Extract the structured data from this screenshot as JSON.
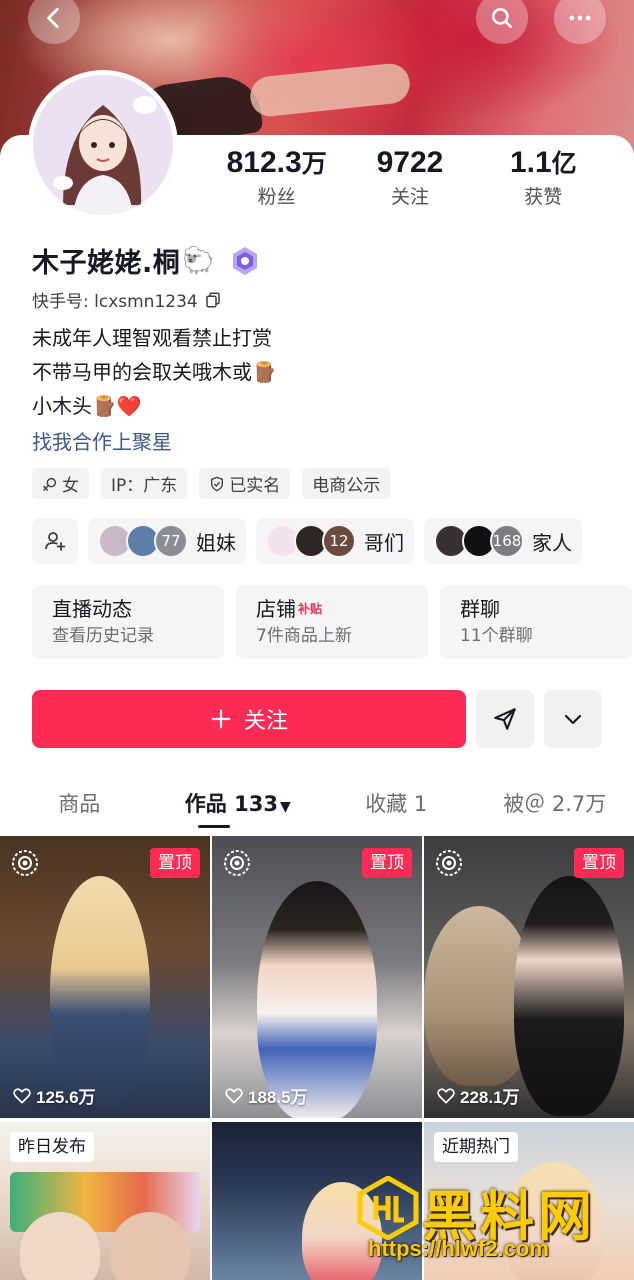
{
  "profile": {
    "name": "木子姥姥.桐",
    "name_emoji": "🐑",
    "kuaishou_id": "快手号: lcxsmn1234",
    "stats": [
      {
        "value": "812.3",
        "unit": "万",
        "label": "粉丝"
      },
      {
        "value": "9722",
        "unit": "",
        "label": "关注"
      },
      {
        "value": "1.1",
        "unit": "亿",
        "label": "获赞"
      }
    ],
    "bio_lines": [
      "未成年人理智观看禁止打赏",
      "不带马甲的会取关哦木或🪵",
      "小木头🪵❤️"
    ],
    "cooperate_link": "找我合作上聚星",
    "tags": [
      {
        "icon": "female-icon",
        "text": "女"
      },
      {
        "icon": "",
        "text": "IP：广东"
      },
      {
        "icon": "verified-shield-icon",
        "text": "已实名"
      },
      {
        "icon": "",
        "text": "电商公示"
      }
    ]
  },
  "groups": [
    {
      "label": "姐妹",
      "count": "77"
    },
    {
      "label": "哥们",
      "count": "12"
    },
    {
      "label": "家人",
      "count": "168"
    }
  ],
  "feature_cards": [
    {
      "title": "直播动态",
      "badge": "",
      "subtitle": "查看历史记录"
    },
    {
      "title": "店铺",
      "badge": "补贴",
      "subtitle": "7件商品上新"
    },
    {
      "title": "群聊",
      "badge": "",
      "subtitle": "11个群聊"
    }
  ],
  "actions": {
    "follow_label": "关注"
  },
  "tabs": [
    {
      "label": "商品"
    },
    {
      "label": "作品 133"
    },
    {
      "label": "收藏 1"
    },
    {
      "label": "被＠ 2.7万"
    }
  ],
  "videos": [
    {
      "pinned_label": "置顶",
      "likes": "125.6万"
    },
    {
      "pinned_label": "置顶",
      "likes": "188.5万"
    },
    {
      "pinned_label": "置顶",
      "likes": "228.1万"
    },
    {
      "corner_label": "昨日发布"
    },
    {
      "corner_label": ""
    },
    {
      "corner_label": "近期热门"
    }
  ],
  "watermark": {
    "brand": "黑料网",
    "url": "https://hlwf2.com"
  },
  "colors": {
    "accent": "#fe2c55",
    "link": "#3a5a8f"
  }
}
